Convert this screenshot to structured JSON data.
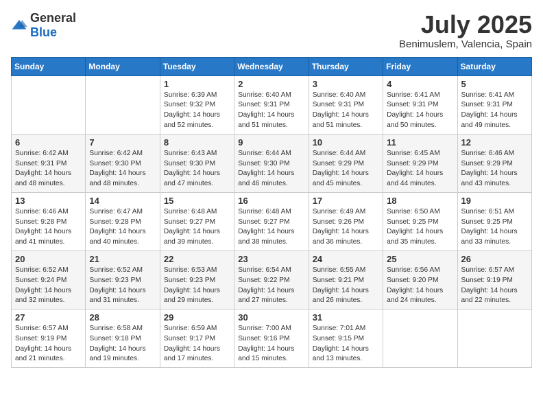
{
  "logo": {
    "general": "General",
    "blue": "Blue"
  },
  "header": {
    "month": "July 2025",
    "location": "Benimuslem, Valencia, Spain"
  },
  "weekdays": [
    "Sunday",
    "Monday",
    "Tuesday",
    "Wednesday",
    "Thursday",
    "Friday",
    "Saturday"
  ],
  "weeks": [
    [
      {
        "day": "",
        "content": ""
      },
      {
        "day": "",
        "content": ""
      },
      {
        "day": "1",
        "content": "Sunrise: 6:39 AM\nSunset: 9:32 PM\nDaylight: 14 hours and 52 minutes."
      },
      {
        "day": "2",
        "content": "Sunrise: 6:40 AM\nSunset: 9:31 PM\nDaylight: 14 hours and 51 minutes."
      },
      {
        "day": "3",
        "content": "Sunrise: 6:40 AM\nSunset: 9:31 PM\nDaylight: 14 hours and 51 minutes."
      },
      {
        "day": "4",
        "content": "Sunrise: 6:41 AM\nSunset: 9:31 PM\nDaylight: 14 hours and 50 minutes."
      },
      {
        "day": "5",
        "content": "Sunrise: 6:41 AM\nSunset: 9:31 PM\nDaylight: 14 hours and 49 minutes."
      }
    ],
    [
      {
        "day": "6",
        "content": "Sunrise: 6:42 AM\nSunset: 9:31 PM\nDaylight: 14 hours and 48 minutes."
      },
      {
        "day": "7",
        "content": "Sunrise: 6:42 AM\nSunset: 9:30 PM\nDaylight: 14 hours and 48 minutes."
      },
      {
        "day": "8",
        "content": "Sunrise: 6:43 AM\nSunset: 9:30 PM\nDaylight: 14 hours and 47 minutes."
      },
      {
        "day": "9",
        "content": "Sunrise: 6:44 AM\nSunset: 9:30 PM\nDaylight: 14 hours and 46 minutes."
      },
      {
        "day": "10",
        "content": "Sunrise: 6:44 AM\nSunset: 9:29 PM\nDaylight: 14 hours and 45 minutes."
      },
      {
        "day": "11",
        "content": "Sunrise: 6:45 AM\nSunset: 9:29 PM\nDaylight: 14 hours and 44 minutes."
      },
      {
        "day": "12",
        "content": "Sunrise: 6:46 AM\nSunset: 9:29 PM\nDaylight: 14 hours and 43 minutes."
      }
    ],
    [
      {
        "day": "13",
        "content": "Sunrise: 6:46 AM\nSunset: 9:28 PM\nDaylight: 14 hours and 41 minutes."
      },
      {
        "day": "14",
        "content": "Sunrise: 6:47 AM\nSunset: 9:28 PM\nDaylight: 14 hours and 40 minutes."
      },
      {
        "day": "15",
        "content": "Sunrise: 6:48 AM\nSunset: 9:27 PM\nDaylight: 14 hours and 39 minutes."
      },
      {
        "day": "16",
        "content": "Sunrise: 6:48 AM\nSunset: 9:27 PM\nDaylight: 14 hours and 38 minutes."
      },
      {
        "day": "17",
        "content": "Sunrise: 6:49 AM\nSunset: 9:26 PM\nDaylight: 14 hours and 36 minutes."
      },
      {
        "day": "18",
        "content": "Sunrise: 6:50 AM\nSunset: 9:25 PM\nDaylight: 14 hours and 35 minutes."
      },
      {
        "day": "19",
        "content": "Sunrise: 6:51 AM\nSunset: 9:25 PM\nDaylight: 14 hours and 33 minutes."
      }
    ],
    [
      {
        "day": "20",
        "content": "Sunrise: 6:52 AM\nSunset: 9:24 PM\nDaylight: 14 hours and 32 minutes."
      },
      {
        "day": "21",
        "content": "Sunrise: 6:52 AM\nSunset: 9:23 PM\nDaylight: 14 hours and 31 minutes."
      },
      {
        "day": "22",
        "content": "Sunrise: 6:53 AM\nSunset: 9:23 PM\nDaylight: 14 hours and 29 minutes."
      },
      {
        "day": "23",
        "content": "Sunrise: 6:54 AM\nSunset: 9:22 PM\nDaylight: 14 hours and 27 minutes."
      },
      {
        "day": "24",
        "content": "Sunrise: 6:55 AM\nSunset: 9:21 PM\nDaylight: 14 hours and 26 minutes."
      },
      {
        "day": "25",
        "content": "Sunrise: 6:56 AM\nSunset: 9:20 PM\nDaylight: 14 hours and 24 minutes."
      },
      {
        "day": "26",
        "content": "Sunrise: 6:57 AM\nSunset: 9:19 PM\nDaylight: 14 hours and 22 minutes."
      }
    ],
    [
      {
        "day": "27",
        "content": "Sunrise: 6:57 AM\nSunset: 9:19 PM\nDaylight: 14 hours and 21 minutes."
      },
      {
        "day": "28",
        "content": "Sunrise: 6:58 AM\nSunset: 9:18 PM\nDaylight: 14 hours and 19 minutes."
      },
      {
        "day": "29",
        "content": "Sunrise: 6:59 AM\nSunset: 9:17 PM\nDaylight: 14 hours and 17 minutes."
      },
      {
        "day": "30",
        "content": "Sunrise: 7:00 AM\nSunset: 9:16 PM\nDaylight: 14 hours and 15 minutes."
      },
      {
        "day": "31",
        "content": "Sunrise: 7:01 AM\nSunset: 9:15 PM\nDaylight: 14 hours and 13 minutes."
      },
      {
        "day": "",
        "content": ""
      },
      {
        "day": "",
        "content": ""
      }
    ]
  ]
}
